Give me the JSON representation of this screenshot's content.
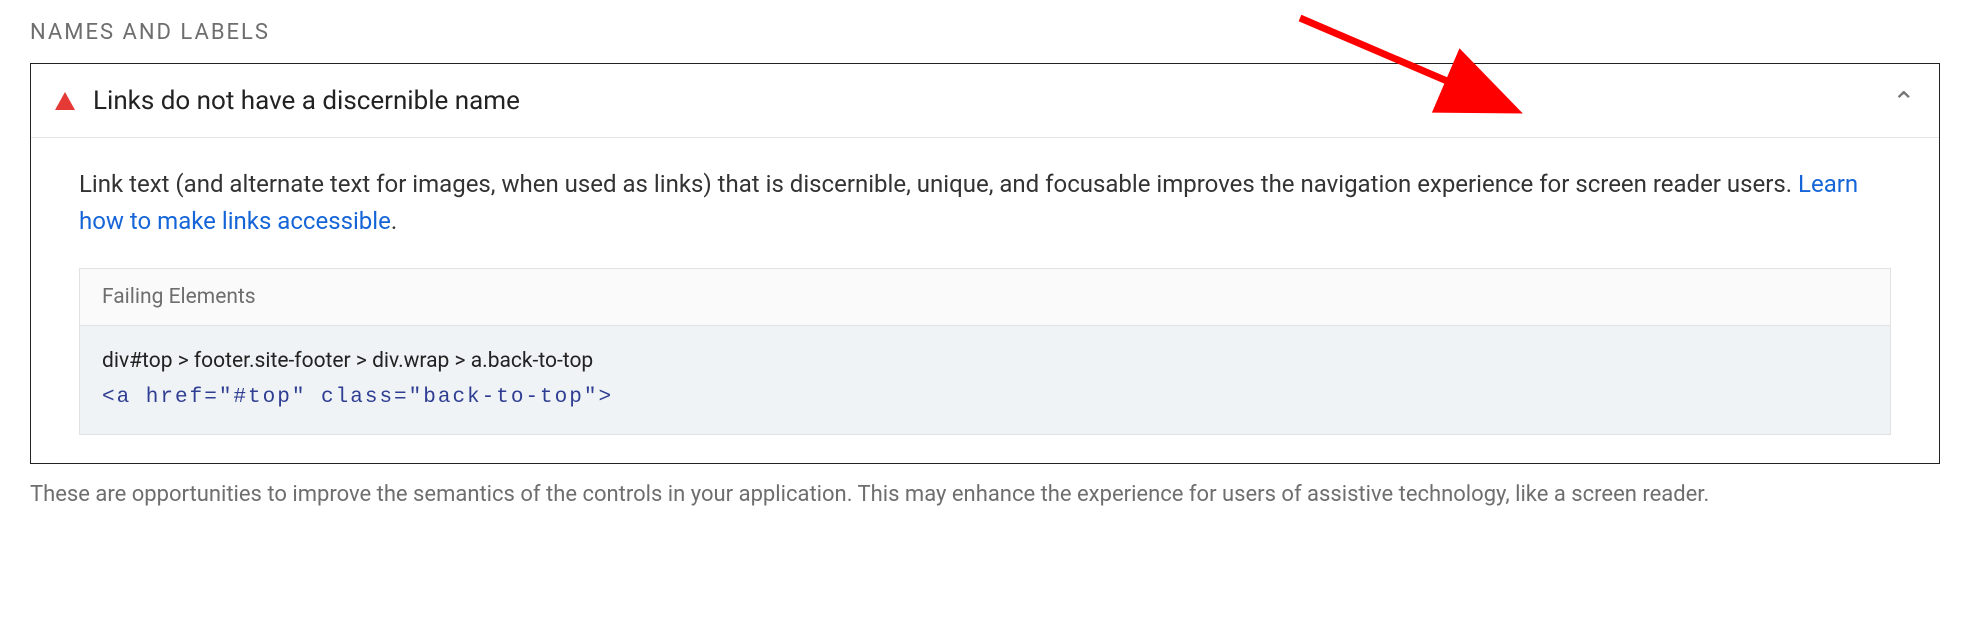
{
  "section": {
    "title": "NAMES AND LABELS"
  },
  "audit": {
    "title": "Links do not have a discernible name",
    "description_text": "Link text (and alternate text for images, when used as links) that is discernible, unique, and focusable improves the navigation experience for screen reader users. ",
    "learn_link": "Learn how to make links accessible",
    "period": "."
  },
  "failing": {
    "header": "Failing Elements",
    "selector": "div#top > footer.site-footer > div.wrap > a.back-to-top",
    "snippet": "<a href=\"#top\" class=\"back-to-top\">"
  },
  "footnote": "These are opportunities to improve the semantics of the controls in your application. This may enhance the experience for users of assistive technology, like a screen reader."
}
